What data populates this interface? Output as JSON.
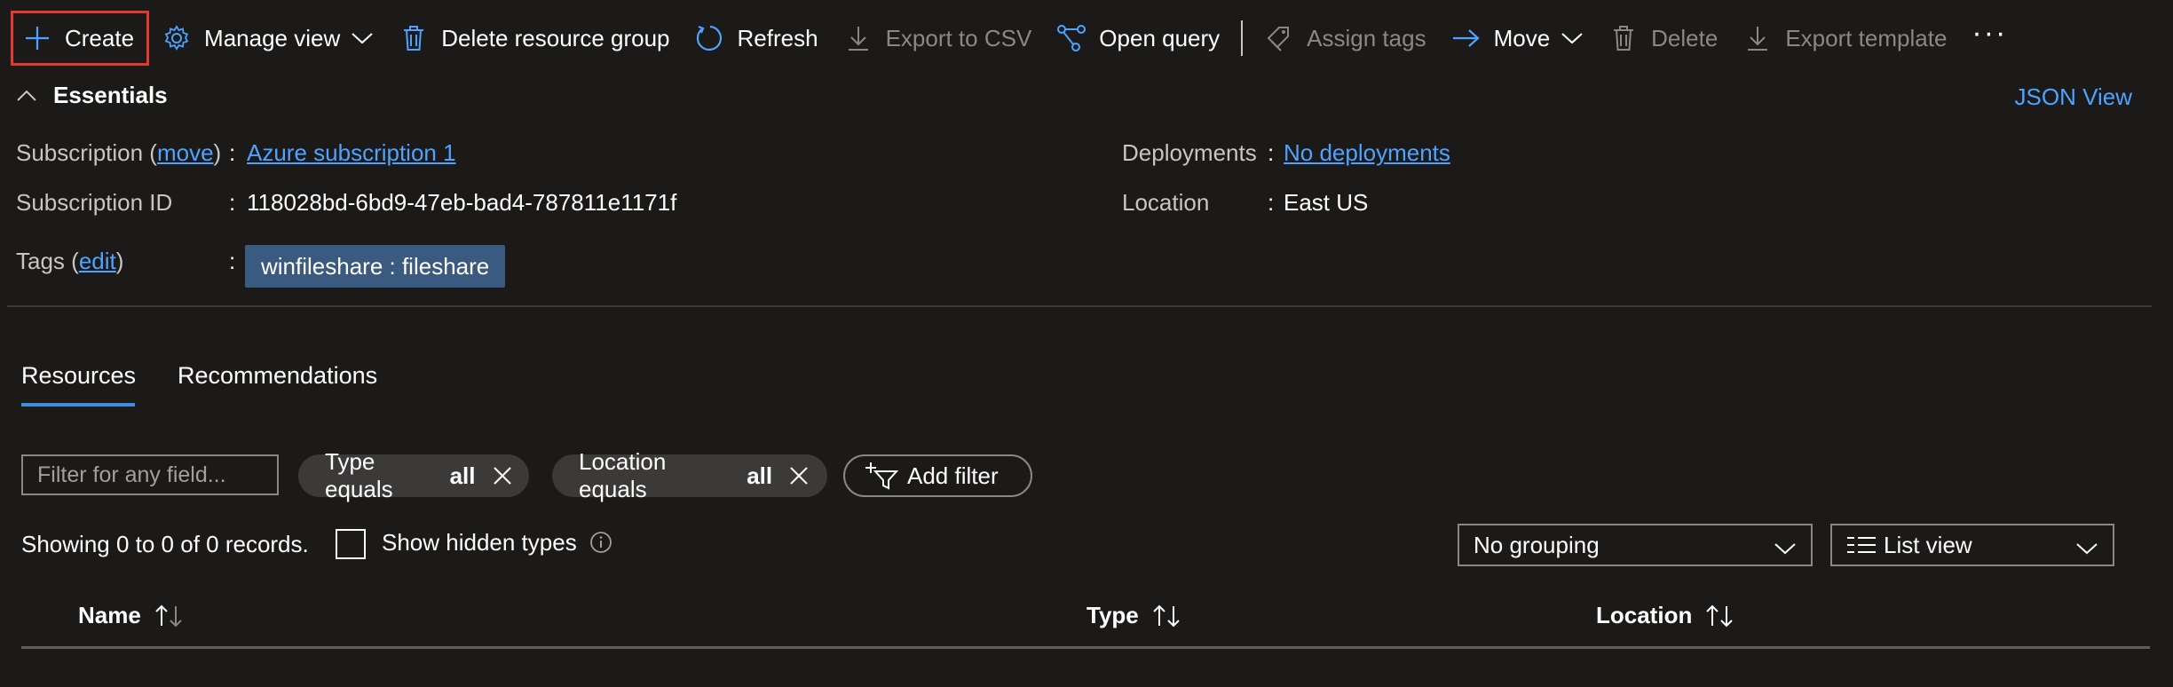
{
  "toolbar": {
    "create": "Create",
    "manage_view": "Manage view",
    "delete_group": "Delete resource group",
    "refresh": "Refresh",
    "export_csv": "Export to CSV",
    "open_query": "Open query",
    "assign_tags": "Assign tags",
    "move": "Move",
    "delete": "Delete",
    "export_template": "Export template",
    "more": "···"
  },
  "essentials": {
    "title": "Essentials",
    "json_view": "JSON View",
    "subscription_label": "Subscription (",
    "subscription_move": "move",
    "subscription_label_end": ")",
    "subscription_value": "Azure subscription 1",
    "subscription_id_label": "Subscription ID",
    "subscription_id_value": "118028bd-6bd9-47eb-bad4-787811e1171f",
    "tags_label": "Tags (",
    "tags_edit": "edit",
    "tags_label_end": ")",
    "tag_value": "winfileshare : fileshare",
    "deployments_label": "Deployments",
    "deployments_value": "No deployments",
    "location_label": "Location",
    "location_value": "East US",
    "colon": ":"
  },
  "tabs": {
    "resources": "Resources",
    "recommendations": "Recommendations"
  },
  "filters": {
    "placeholder": "Filter for any field...",
    "type_prefix": "Type equals",
    "type_value": "all",
    "location_prefix": "Location equals",
    "location_value": "all",
    "add_filter": "Add filter"
  },
  "records": {
    "showing": "Showing 0 to 0 of 0 records.",
    "show_hidden": "Show hidden types"
  },
  "grouping": {
    "selected": "No grouping"
  },
  "view": {
    "selected": "List view"
  },
  "table": {
    "columns": [
      "Name",
      "Type",
      "Location"
    ]
  },
  "colors": {
    "background": "#1b1a19",
    "link": "#4da3ff",
    "accent": "#3b8de0",
    "tag_bg": "#3a5a80",
    "create_highlight": "#e03b2b"
  }
}
